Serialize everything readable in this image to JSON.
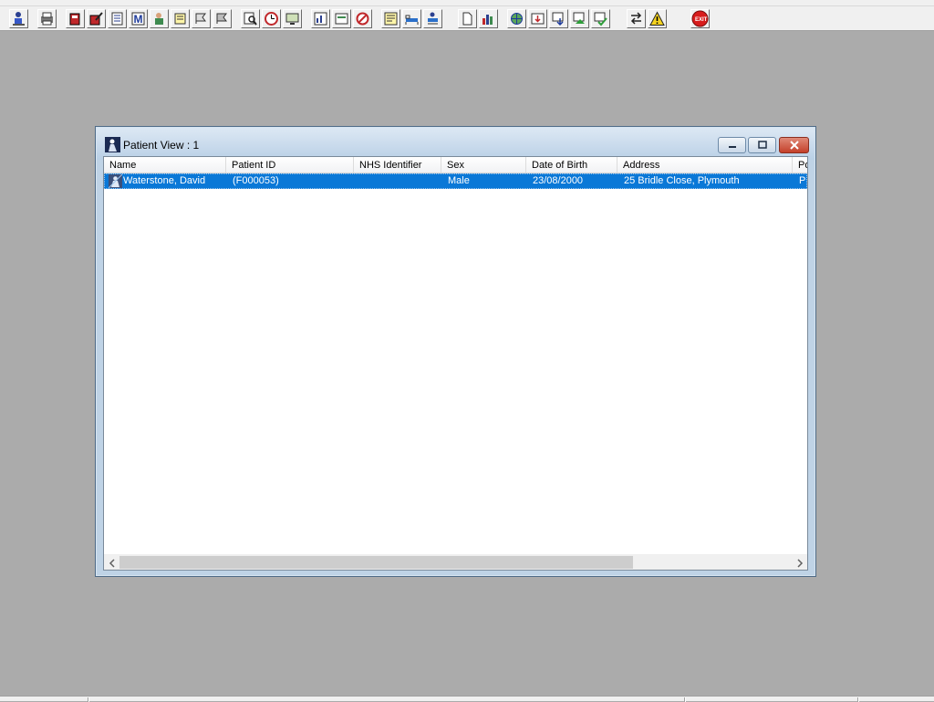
{
  "toolbar": {
    "buttons": [
      {
        "icon": "patient-icon"
      },
      {
        "icon": "print-icon"
      },
      {
        "icon": "book-icon"
      },
      {
        "icon": "edit-record-icon"
      },
      {
        "icon": "document-list-icon"
      },
      {
        "icon": "letter-m-icon"
      },
      {
        "icon": "doctor-icon"
      },
      {
        "icon": "notes-icon"
      },
      {
        "icon": "flag-icon"
      },
      {
        "icon": "flag-alt-icon"
      },
      {
        "icon": "search-icon"
      },
      {
        "icon": "clock-icon"
      },
      {
        "icon": "monitor-icon"
      },
      {
        "icon": "chart-window-icon"
      },
      {
        "icon": "form-icon"
      },
      {
        "icon": "no-entry-icon"
      },
      {
        "icon": "memo-icon"
      },
      {
        "icon": "bed-icon"
      },
      {
        "icon": "transfer-icon"
      },
      {
        "icon": "page-icon"
      },
      {
        "icon": "bar-chart-icon"
      },
      {
        "icon": "globe-icon"
      },
      {
        "icon": "inbox-icon"
      },
      {
        "icon": "download-icon"
      },
      {
        "icon": "green-arrow-icon"
      },
      {
        "icon": "green-check-icon"
      },
      {
        "icon": "swap-icon"
      },
      {
        "icon": "warning-icon"
      },
      {
        "icon": "exit-icon"
      }
    ],
    "exit_label": "EXIT"
  },
  "window": {
    "title": "Patient View : 1",
    "columns": [
      "Name",
      "Patient ID",
      "NHS Identifier",
      "Sex",
      "Date of Birth",
      "Address",
      "Po"
    ],
    "rows": [
      {
        "name": "Waterstone, David",
        "patient_id": "(F000053)",
        "nhs_identifier": "",
        "sex": "Male",
        "date_of_birth": "23/08/2000",
        "address": "25 Bridle Close, Plymouth",
        "postcode": "PL"
      }
    ]
  },
  "colors": {
    "desktop": "#ababab",
    "selection": "#0a78d7",
    "close_button": "#c4402a"
  }
}
